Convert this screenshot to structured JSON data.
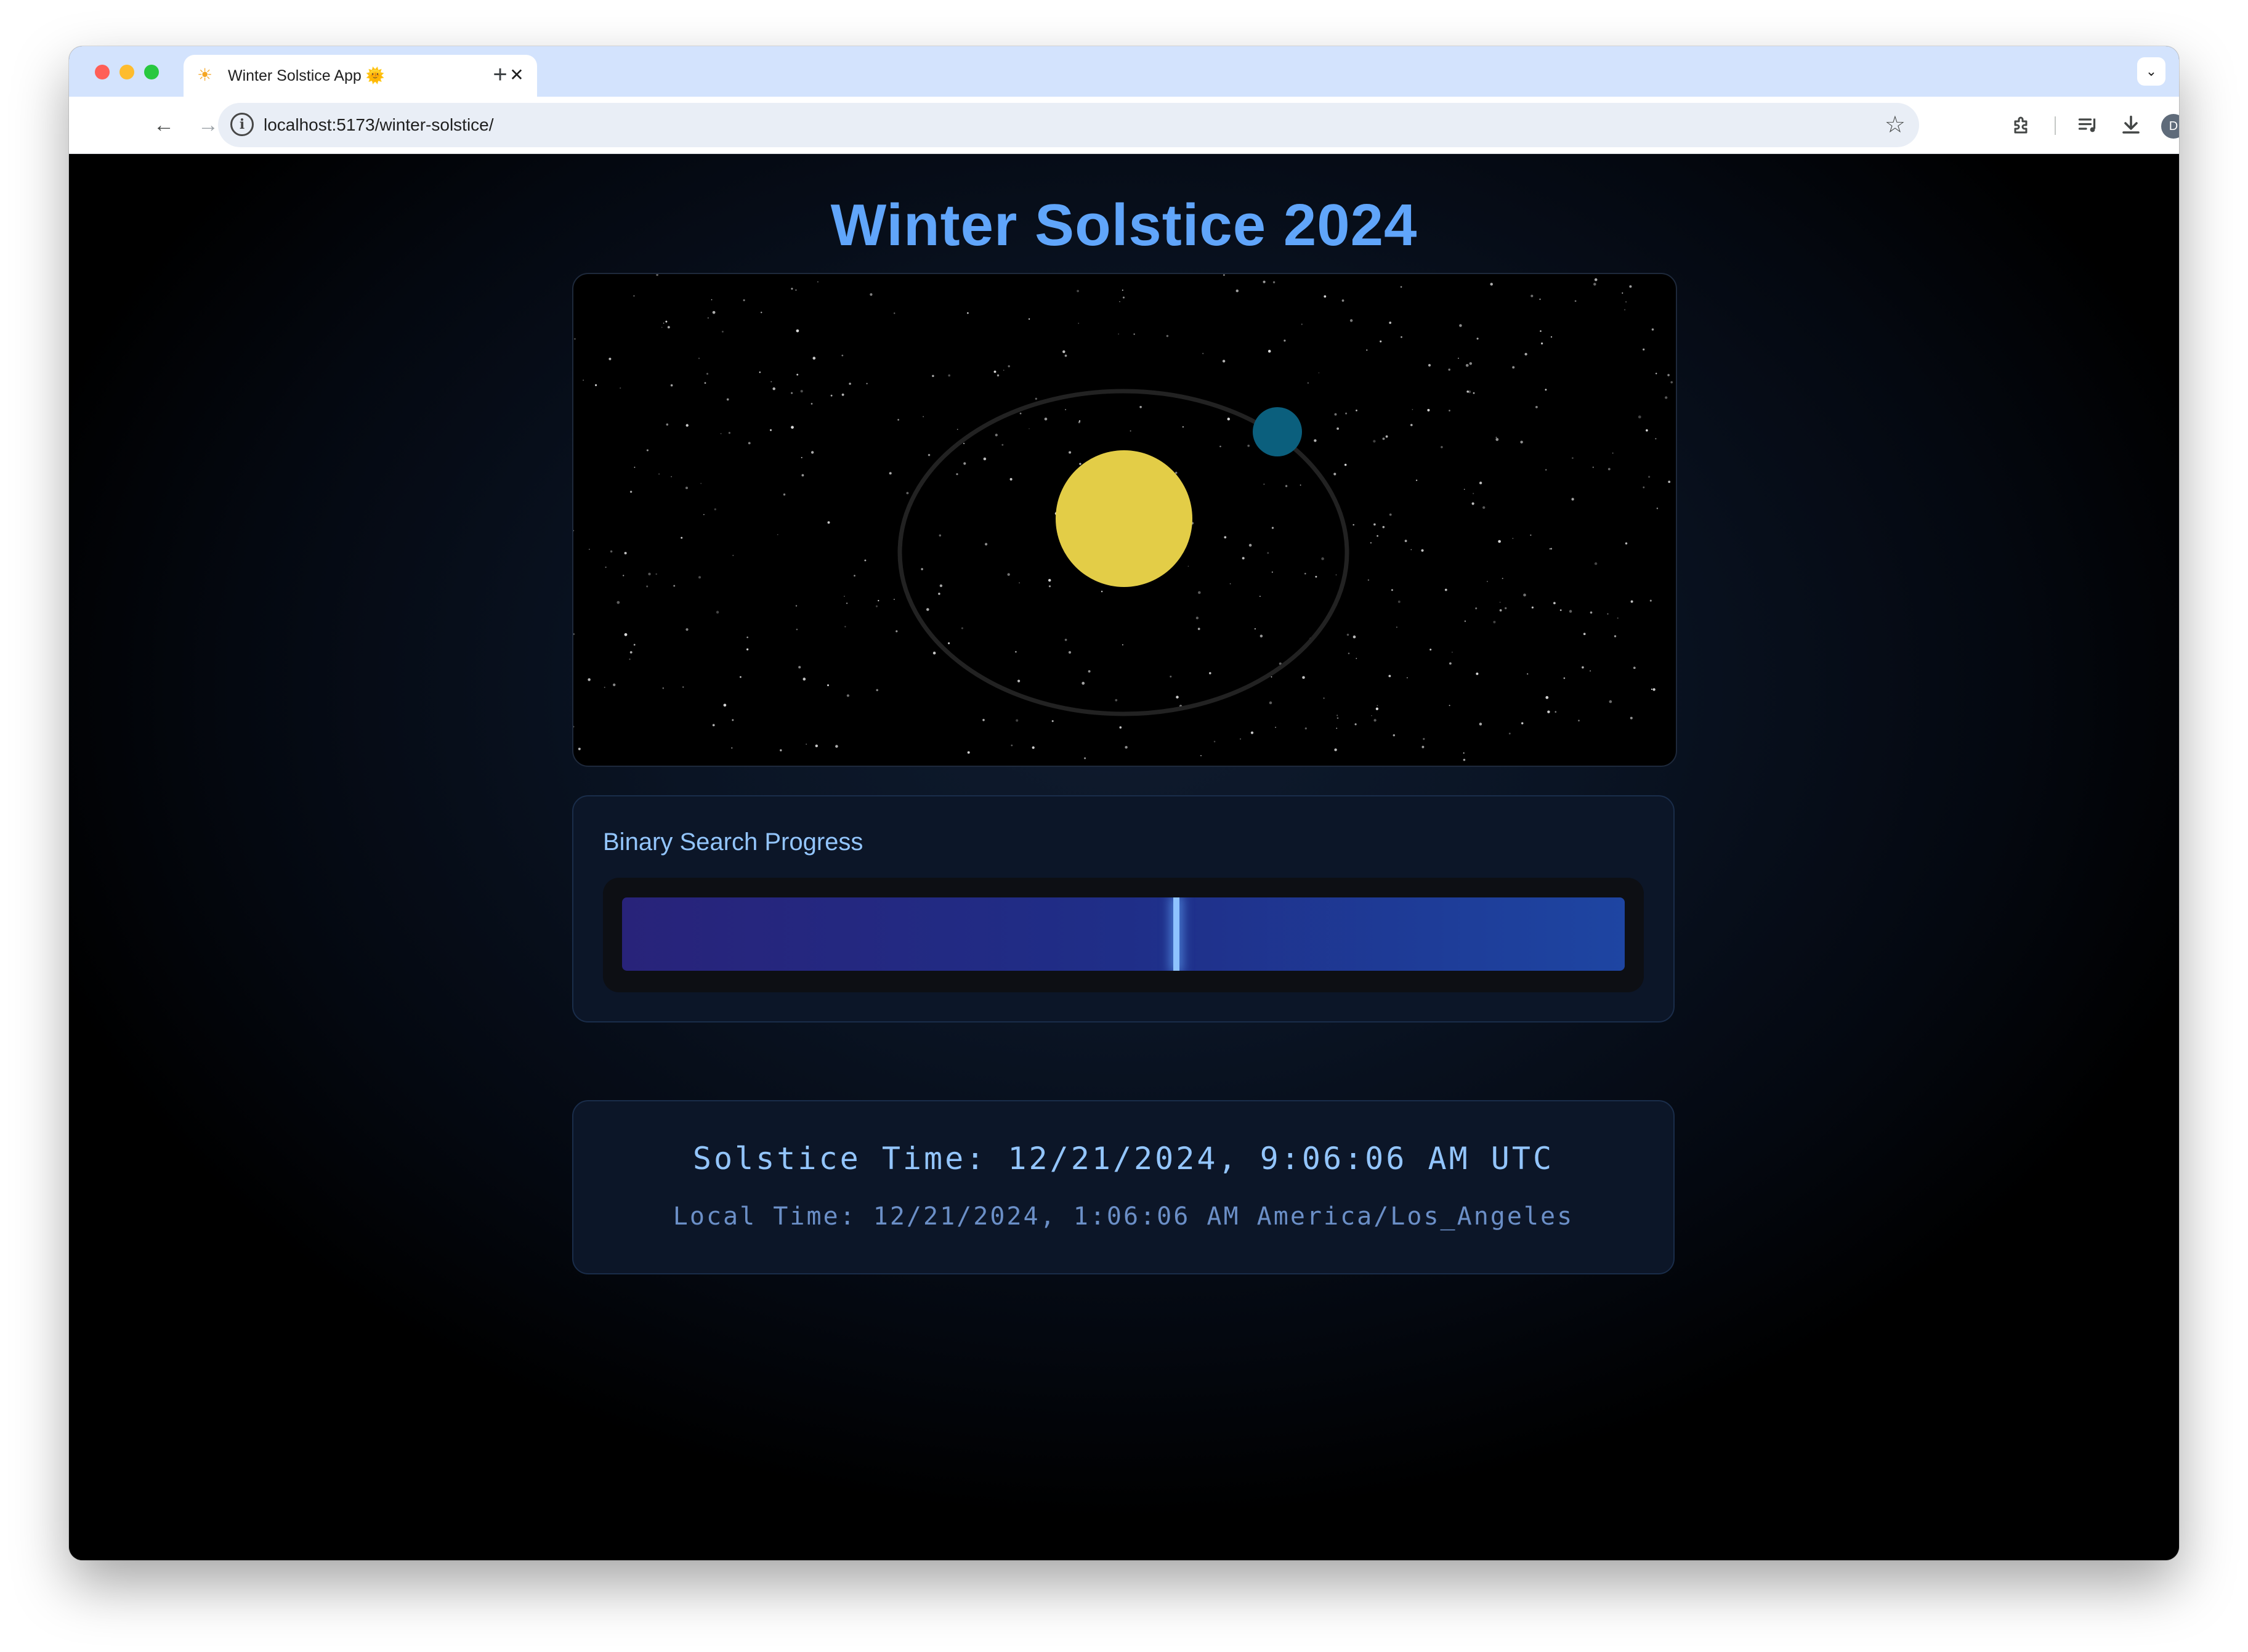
{
  "browser": {
    "tab_title": "Winter Solstice App 🌞",
    "favicon": "☀",
    "tab_close": "✕",
    "new_tab": "+",
    "tab_search": "⌄",
    "url": "localhost:5173/winter-solstice/",
    "avatar_letter": "D",
    "icons": [
      "back-arrow-icon",
      "forward-arrow-icon",
      "reload-icon",
      "site-info-icon",
      "bookmark-star-icon",
      "extensions-icon",
      "media-controls-icon",
      "download-icon",
      "avatar",
      "more-menu-icon"
    ]
  },
  "page": {
    "title": "Winter Solstice 2024"
  },
  "scene": {
    "sun_color": "#e3cd47",
    "planet_color": "#0b5f7d",
    "orbit_color": "#222222",
    "star_color": "#ffffff"
  },
  "progress": {
    "label": "Binary Search Progress",
    "marker_fraction": 0.553,
    "bar_gradient_start": "#28237a",
    "bar_gradient_end": "#1e45a2",
    "marker_color": "#8ec3ff"
  },
  "solstice": {
    "utc_text": "Solstice Time: 12/21/2024, 9:06:06 AM UTC",
    "local_text": "Local Time: 12/21/2024, 1:06:06 AM America/Los_Angeles"
  }
}
